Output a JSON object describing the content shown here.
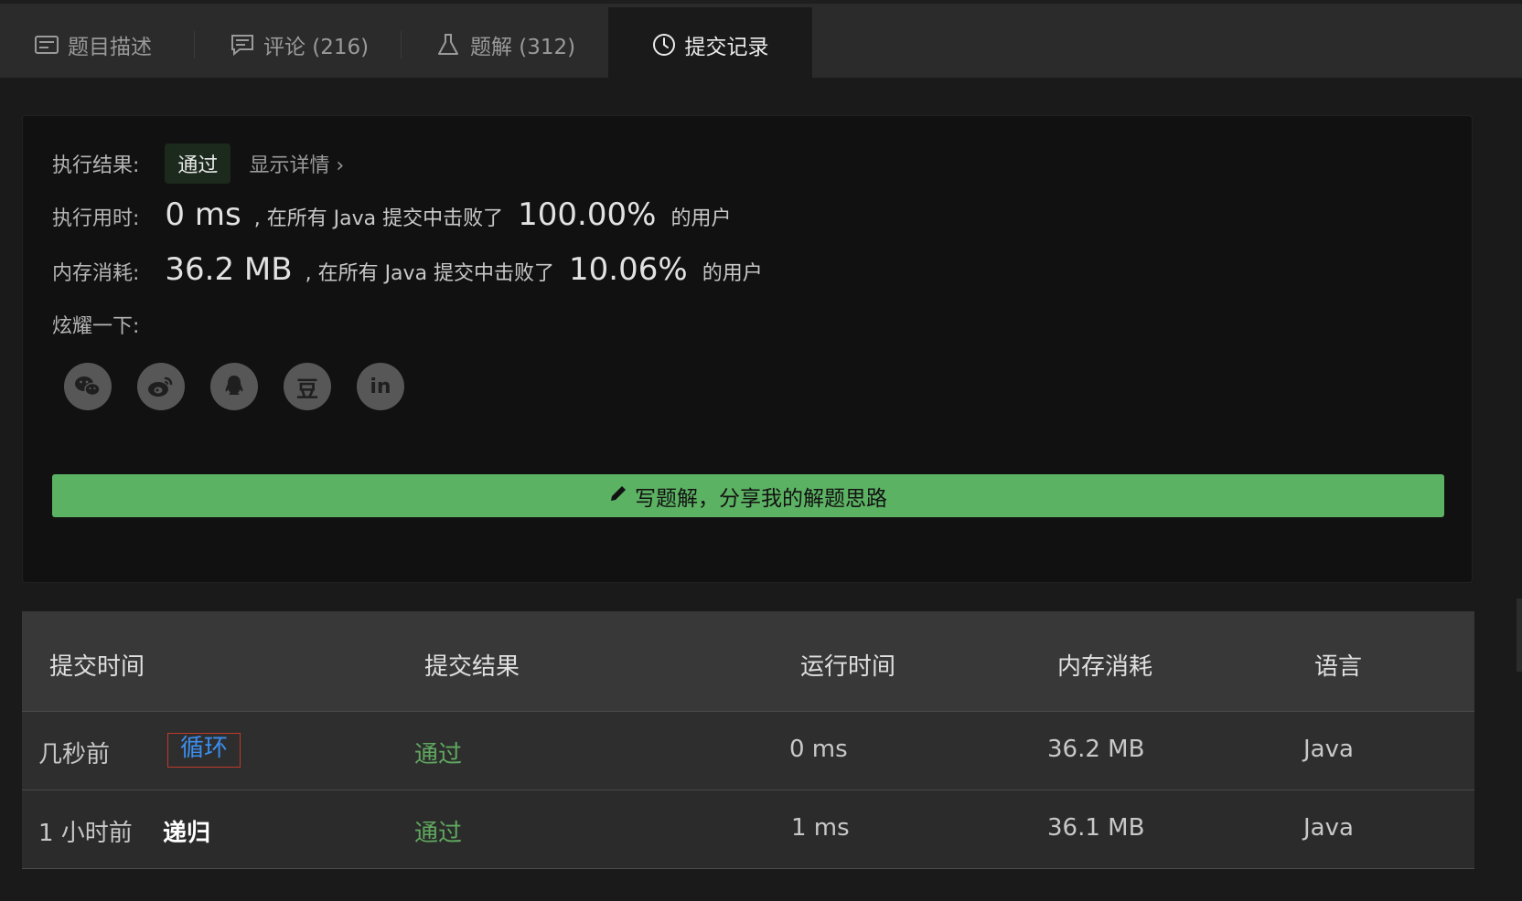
{
  "tabs": [
    {
      "label": "题目描述",
      "icon": "description-icon"
    },
    {
      "label": "评论 (216)",
      "icon": "comment-icon"
    },
    {
      "label": "题解 (312)",
      "icon": "flask-icon"
    },
    {
      "label": "提交记录",
      "icon": "clock-icon",
      "active": true
    }
  ],
  "result": {
    "label": "执行结果:",
    "status": "通过",
    "detail_link": "显示详情 ›",
    "time_label": "执行用时:",
    "time_value": "0 ms",
    "time_mid": ", 在所有 Java 提交中击败了",
    "time_pct": "100.00%",
    "time_tail": "的用户",
    "mem_label": "内存消耗:",
    "mem_value": "36.2 MB",
    "mem_mid": ", 在所有 Java 提交中击败了",
    "mem_pct": "10.06%",
    "mem_tail": "的用户",
    "share_label": "炫耀一下:",
    "share_icons": [
      "wechat-icon",
      "weibo-icon",
      "qq-icon",
      "douban-icon",
      "linkedin-icon"
    ],
    "douban_glyph": "豆",
    "linkedin_glyph": "in",
    "write_button": "写题解，分享我的解题思路"
  },
  "table": {
    "headers": [
      "提交时间",
      "提交结果",
      "运行时间",
      "内存消耗",
      "语言"
    ],
    "rows": [
      {
        "time": "几秒前",
        "tag": "循环",
        "result": "通过",
        "runtime": "0 ms",
        "memory": "36.2 MB",
        "lang": "Java"
      },
      {
        "time": "1 小时前",
        "tag": "递归",
        "result": "通过",
        "runtime": "1 ms",
        "memory": "36.1 MB",
        "lang": "Java"
      }
    ]
  },
  "colors": {
    "accent_green": "#5cb263",
    "pass_green": "#5fa85f",
    "tag_blue": "#3b8ef0",
    "tag_border": "#c0392b"
  }
}
